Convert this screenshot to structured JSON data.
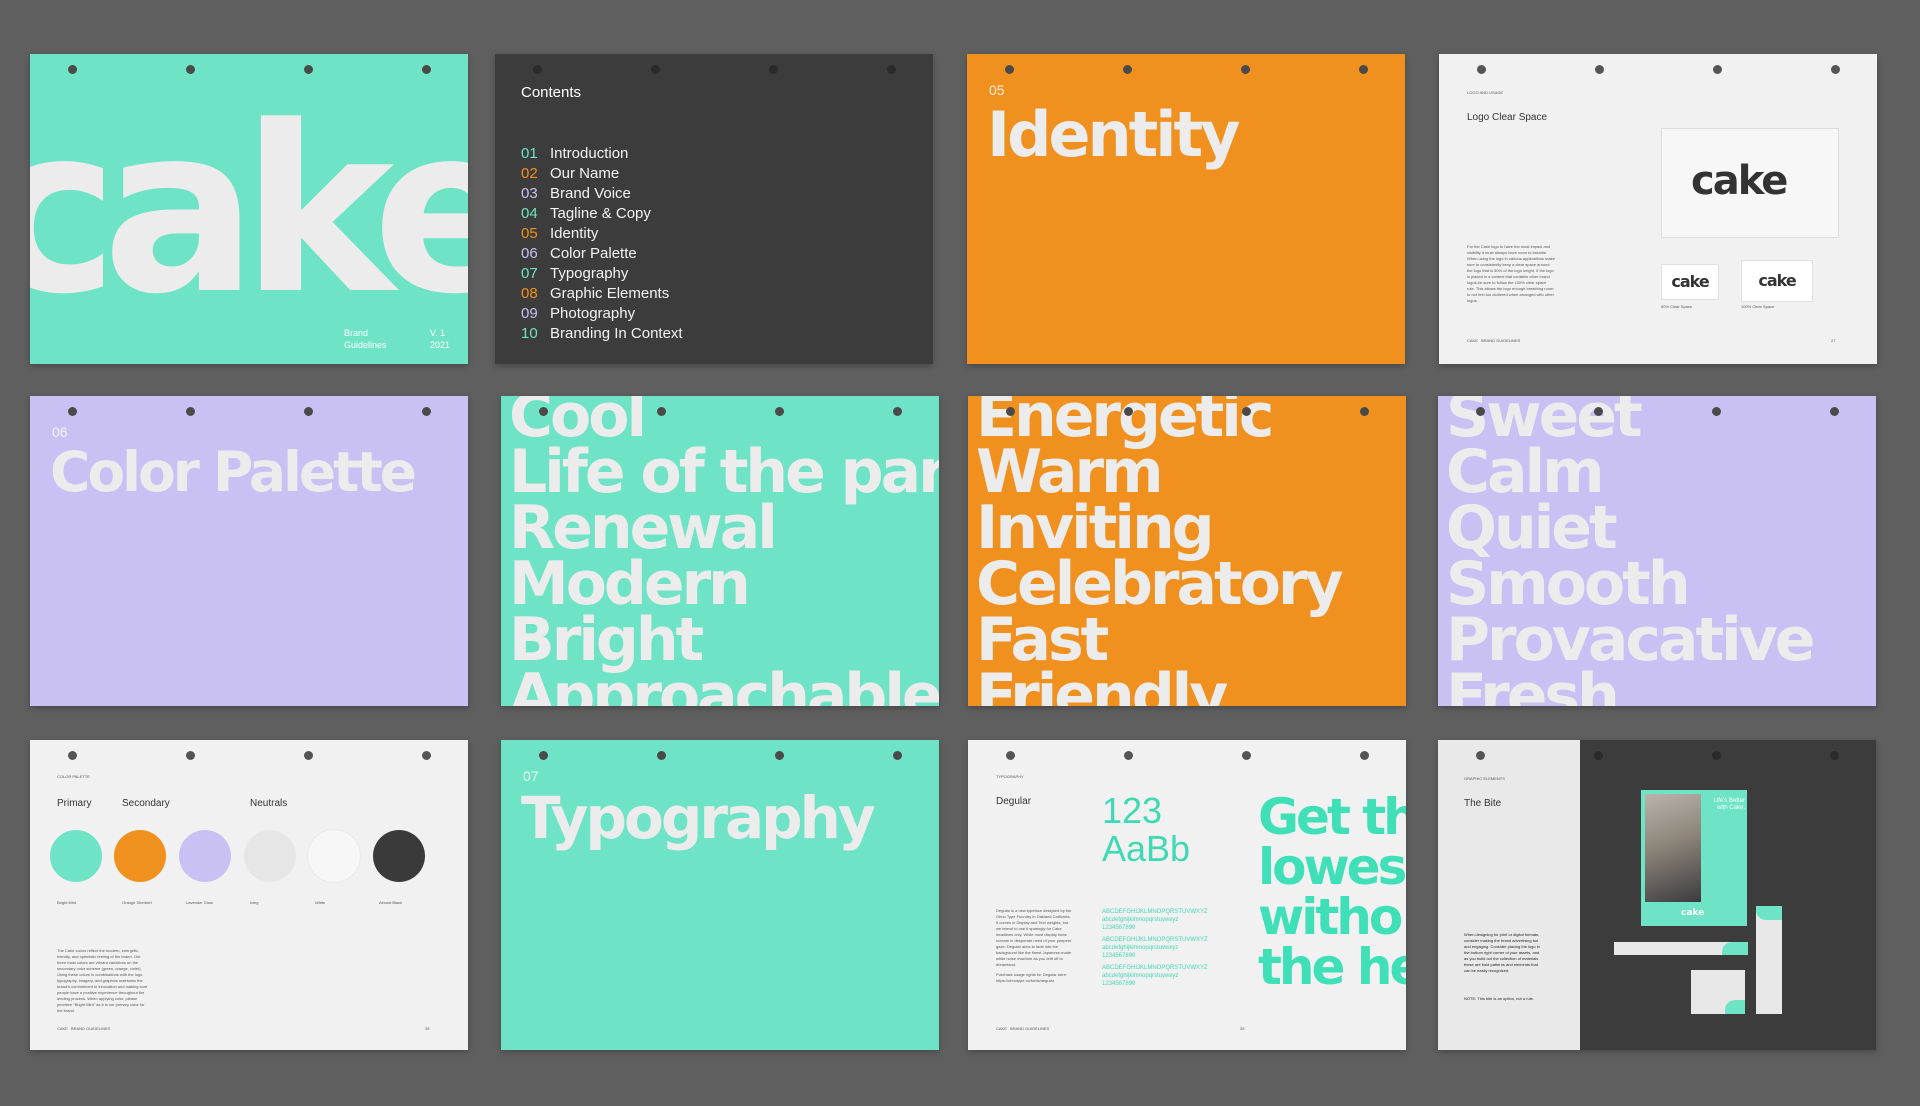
{
  "cover": {
    "word": "cake",
    "brand_line1": "Brand",
    "brand_line2": "Guidelines",
    "version": "V. 1",
    "year": "2021"
  },
  "contents": {
    "title": "Contents",
    "items": [
      {
        "num": "01",
        "label": "Introduction",
        "color": "#6fe3c6"
      },
      {
        "num": "02",
        "label": "Our Name",
        "color": "#f0901e"
      },
      {
        "num": "03",
        "label": "Brand Voice",
        "color": "#c9c1f4"
      },
      {
        "num": "04",
        "label": "Tagline & Copy",
        "color": "#6fe3c6"
      },
      {
        "num": "05",
        "label": "Identity",
        "color": "#f0901e"
      },
      {
        "num": "06",
        "label": "Color Palette",
        "color": "#c9c1f4"
      },
      {
        "num": "07",
        "label": "Typography",
        "color": "#6fe3c6"
      },
      {
        "num": "08",
        "label": "Graphic Elements",
        "color": "#f0901e"
      },
      {
        "num": "09",
        "label": "Photography",
        "color": "#c9c1f4"
      },
      {
        "num": "10",
        "label": "Branding In Context",
        "color": "#6fe3c6"
      }
    ]
  },
  "identity": {
    "num": "05",
    "title": "Identity"
  },
  "logo_space": {
    "section": "LOGO AND USAGE",
    "title": "Logo Clear Space",
    "logo": "cake",
    "body": "For the Cake logo to have the most impact and visibility it must always have room to breathe. When using the logo in various applications make sure to consistently keep a clear space around the logo that is 50% of the logo height. If the logo is placed in a context that contains other brand logos be sure to follow the 100% clear space rule. This allows the logo enough breathing room to not feel too cluttered when arranged with other logos.",
    "caption1": "50% Clear Space",
    "caption2": "100% Clear Space",
    "footer_brand": "CAKE",
    "footer_doc": "BRAND GUIDELINES",
    "page": "27"
  },
  "palette_intro": {
    "num": "06",
    "title": "Color Palette"
  },
  "mint_words": [
    "Cool",
    "Life of the par",
    "Renewal",
    "Modern",
    "Bright",
    "Approachable"
  ],
  "orange_words": [
    "Energetic",
    "Warm",
    "Inviting",
    "Celebratory",
    "Fast",
    "Friendly"
  ],
  "lavender_words": [
    "Sweet",
    "Calm",
    "Quiet",
    "Smooth",
    "Provacative",
    "Fresh"
  ],
  "palette": {
    "section": "COLOR PALETTE",
    "primary": "Primary",
    "secondary": "Secondary",
    "neutrals": "Neutrals",
    "swatches": [
      {
        "name": "Bright Mint",
        "hex": "#6fe3c6"
      },
      {
        "name": "Orange Sherbert",
        "hex": "#f0901e"
      },
      {
        "name": "Lavender Glow",
        "hex": "#c9c1f4"
      },
      {
        "name": "Icing",
        "hex": "#e6e6e6"
      },
      {
        "name": "White",
        "hex": "#f7f7f7"
      },
      {
        "name": "Almost Black",
        "hex": "#3a3a3a"
      }
    ],
    "body": "The Cake colors reflect the modern, energetic, friendly, and optimistic feeling of the brand. Our three main colors are vibrant variations on the secondary color scheme (green, orange, violet). Using these colors in combinations with the logo, typography, imagery, and graphics maintains the brand's commitment to innovation and making sure people have a positive experience throughout the lending process. When applying color, please prioritize \"Bright Mint\" as it is our primary color for the brand.",
    "footer_brand": "CAKE",
    "footer_doc": "BRAND GUIDELINES",
    "page": "35"
  },
  "typography_intro": {
    "num": "07",
    "title": "Typography"
  },
  "typeface": {
    "section": "TYPOGRAPHY",
    "name": "Degular",
    "sample1": "123",
    "sample2": "AaBb",
    "alphabet_upper": "ABCDEFGHIJKLMNOPQRSTUVWXYZ",
    "alphabet_lower": "abcdefghijklmnopqrstuvwxyz",
    "digits": "1234567890",
    "body": "Degular is a new typeface designed by the Ohno Type Foundry in Oakland California. It comes in Display and Text weights, but we intend to use it sparingly for Cake headlines only. While most display fonts scream in desperate need of your peepers' gaze, Degular aims to fade into the background like the finest Japanese-made white noise machine as you drift off to dreamland.",
    "purchase": "Purchase usage rights for Degular here: https://ohnotype.co/fonts/degular",
    "headline_lines": [
      "Get th",
      "lowes",
      "witho",
      "the he"
    ],
    "footer_brand": "CAKE",
    "footer_doc": "BRAND GUIDELINES",
    "page": "39"
  },
  "graphic": {
    "section": "GRAPHIC ELEMENTS",
    "title": "The Bite",
    "body": "When designing for print or digital formats, consider making the brand advertising fun and engaging. Consider placing the logo in the bottom right corner of your assets, and as you build out the collection of materials these are bold patterns and elements that can be easily recognized.",
    "note": "NOTE: This bite is an option, not a rule.",
    "poster_line1": "Life's Better",
    "poster_line2": "with Cake.",
    "logo": "cake"
  }
}
